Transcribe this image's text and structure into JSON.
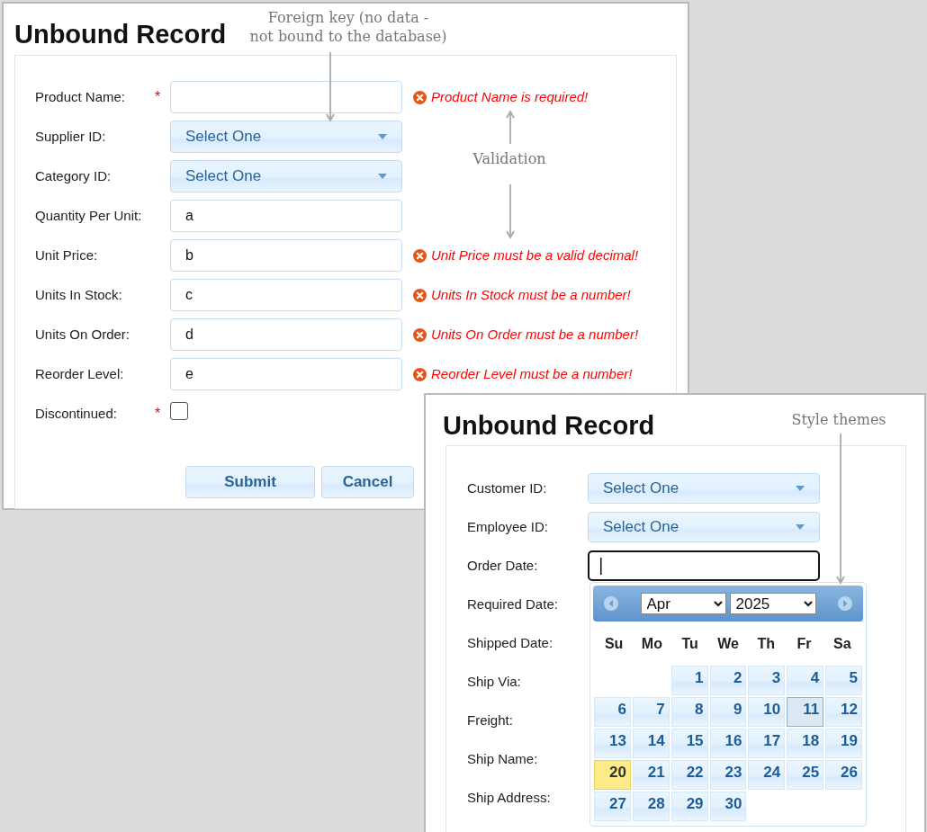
{
  "forms": [
    {
      "title": "Unbound Record",
      "fields": [
        {
          "label": "Product Name:",
          "kind": "text",
          "required_mark": "*",
          "error": "Product Name is required!"
        },
        {
          "label": "Supplier ID:",
          "kind": "select",
          "value": "Select One"
        },
        {
          "label": "Category ID:",
          "kind": "select",
          "value": "Select One"
        },
        {
          "label": "Quantity Per Unit:",
          "kind": "text",
          "value": "a"
        },
        {
          "label": "Unit Price:",
          "kind": "text",
          "value": "b",
          "error": "Unit Price must be a valid decimal!"
        },
        {
          "label": "Units In Stock:",
          "kind": "text",
          "value": "c",
          "error": "Units In Stock must be a number!"
        },
        {
          "label": "Units On Order:",
          "kind": "text",
          "value": "d",
          "error": "Units On Order must be a number!"
        },
        {
          "label": "Reorder Level:",
          "kind": "text",
          "value": "e",
          "error": "Reorder Level must be a number!"
        },
        {
          "label": "Discontinued:",
          "kind": "checkbox",
          "checked": false,
          "required_mark": "*"
        }
      ],
      "buttons": [
        {
          "label": "Submit"
        },
        {
          "label": "Cancel"
        }
      ]
    },
    {
      "title": "Unbound Record",
      "fields": [
        {
          "label": "Customer ID:",
          "kind": "select",
          "value": "Select One"
        },
        {
          "label": "Employee ID:",
          "kind": "select",
          "value": "Select One"
        },
        {
          "label": "Order Date:",
          "kind": "text",
          "focused": true
        },
        {
          "label": "Required Date:",
          "kind": "covered"
        },
        {
          "label": "Shipped Date:",
          "kind": "covered"
        },
        {
          "label": "Ship Via:",
          "kind": "covered"
        },
        {
          "label": "Freight:",
          "kind": "covered"
        },
        {
          "label": "Ship Name:",
          "kind": "covered"
        },
        {
          "label": "Ship Address:",
          "kind": "covered"
        }
      ],
      "calendar": {
        "month": "Apr",
        "year": "2025",
        "weekdays": [
          "Su",
          "Mo",
          "Tu",
          "We",
          "Th",
          "Fr",
          "Sa"
        ],
        "weeks": [
          {
            "days": [
              {
                "kind": "blank"
              },
              {
                "kind": "blank"
              },
              {
                "label": "1",
                "selected": false,
                "today": false
              },
              {
                "label": "2",
                "selected": false,
                "today": false
              },
              {
                "label": "3",
                "selected": false,
                "today": false
              },
              {
                "label": "4",
                "selected": false,
                "today": false
              },
              {
                "label": "5",
                "selected": false,
                "today": false
              }
            ]
          },
          {
            "days": [
              {
                "label": "6",
                "selected": false,
                "today": false
              },
              {
                "label": "7",
                "selected": false,
                "today": false
              },
              {
                "label": "8",
                "selected": false,
                "today": false
              },
              {
                "label": "9",
                "selected": false,
                "today": false
              },
              {
                "label": "10",
                "selected": false,
                "today": false
              },
              {
                "label": "11",
                "selected": true,
                "today": false
              },
              {
                "label": "12",
                "selected": false,
                "today": false
              }
            ]
          },
          {
            "days": [
              {
                "label": "13",
                "selected": false,
                "today": false
              },
              {
                "label": "14",
                "selected": false,
                "today": false
              },
              {
                "label": "15",
                "selected": false,
                "today": false
              },
              {
                "label": "16",
                "selected": false,
                "today": false
              },
              {
                "label": "17",
                "selected": false,
                "today": false
              },
              {
                "label": "18",
                "selected": false,
                "today": false
              },
              {
                "label": "19",
                "selected": false,
                "today": false
              }
            ]
          },
          {
            "days": [
              {
                "label": "20",
                "selected": false,
                "today": true
              },
              {
                "label": "21",
                "selected": false,
                "today": false
              },
              {
                "label": "22",
                "selected": false,
                "today": false
              },
              {
                "label": "23",
                "selected": false,
                "today": false
              },
              {
                "label": "24",
                "selected": false,
                "today": false
              },
              {
                "label": "25",
                "selected": false,
                "today": false
              },
              {
                "label": "26",
                "selected": false,
                "today": false
              }
            ]
          },
          {
            "days": [
              {
                "label": "27",
                "selected": false,
                "today": false
              },
              {
                "label": "28",
                "selected": false,
                "today": false
              },
              {
                "label": "29",
                "selected": false,
                "today": false
              },
              {
                "label": "30",
                "selected": false,
                "today": false
              }
            ]
          }
        ]
      }
    }
  ],
  "annotations": [
    {
      "text": "Foreign key (no data -\nnot bound to the database)"
    },
    {
      "text": "Validation"
    },
    {
      "text": "Style themes"
    }
  ]
}
